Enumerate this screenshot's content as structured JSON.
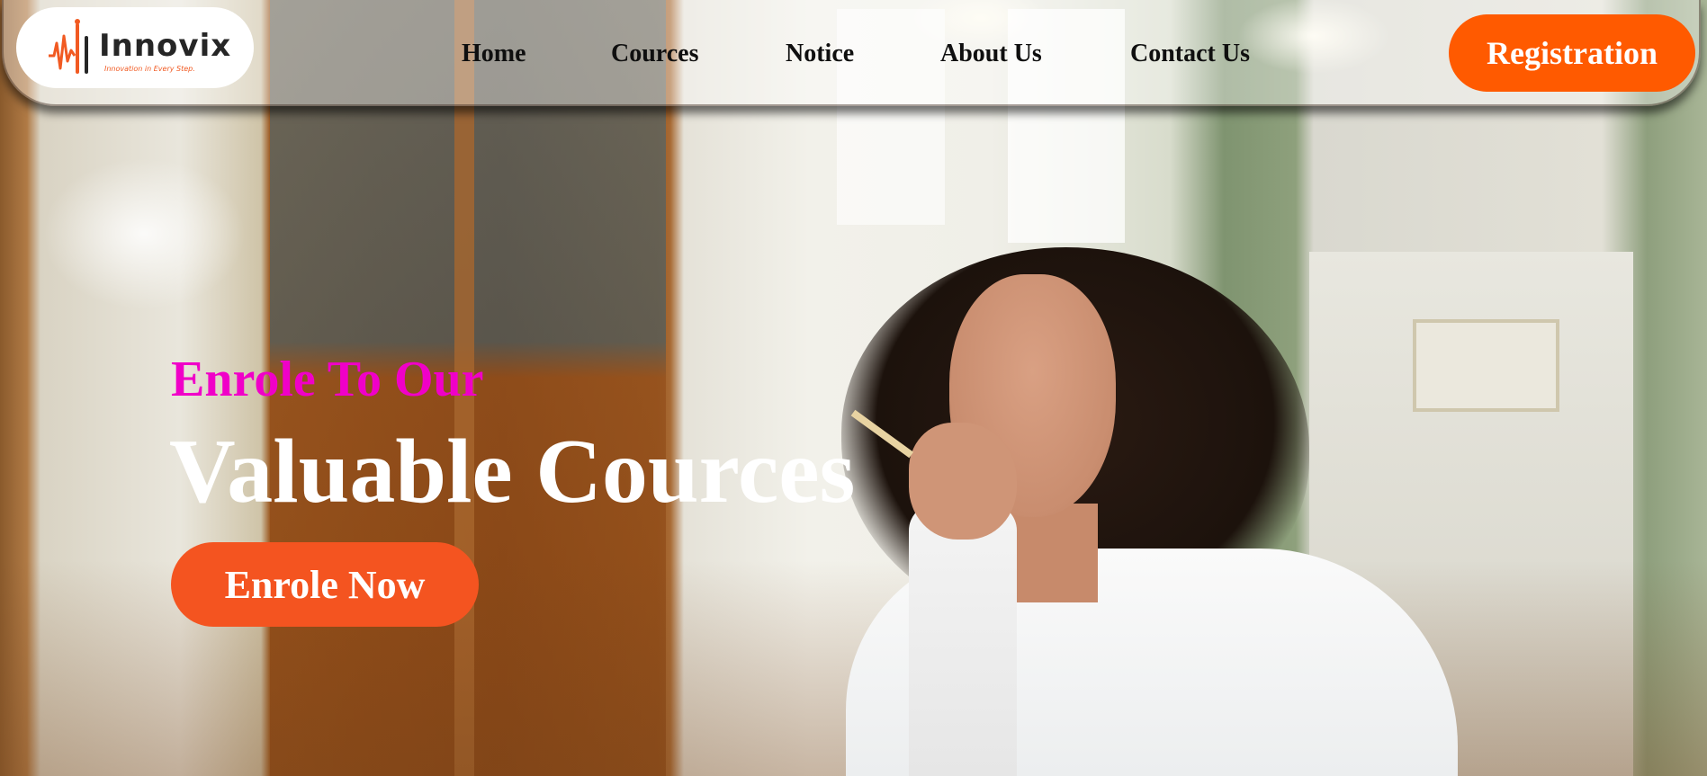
{
  "brand": {
    "name": "Innovix",
    "tagline": "Innovation in Every Step."
  },
  "nav": {
    "links": [
      "Home",
      "Cources",
      "Notice",
      "About Us",
      "Contact Us"
    ],
    "registration_label": "Registration"
  },
  "hero": {
    "subtitle": "Enrole To Our",
    "title": "Valuable Cources",
    "cta_label": "Enrole Now",
    "background_image": "blurred library interior with a young woman in a white shirt resting her chin on her hand, holding a pencil"
  },
  "colors": {
    "accent": "#ff5a00",
    "cta": "#f45420",
    "subtitle_magenta": "#f000c8",
    "title_white": "#ffffff",
    "nav_text": "#0f0f0f"
  }
}
